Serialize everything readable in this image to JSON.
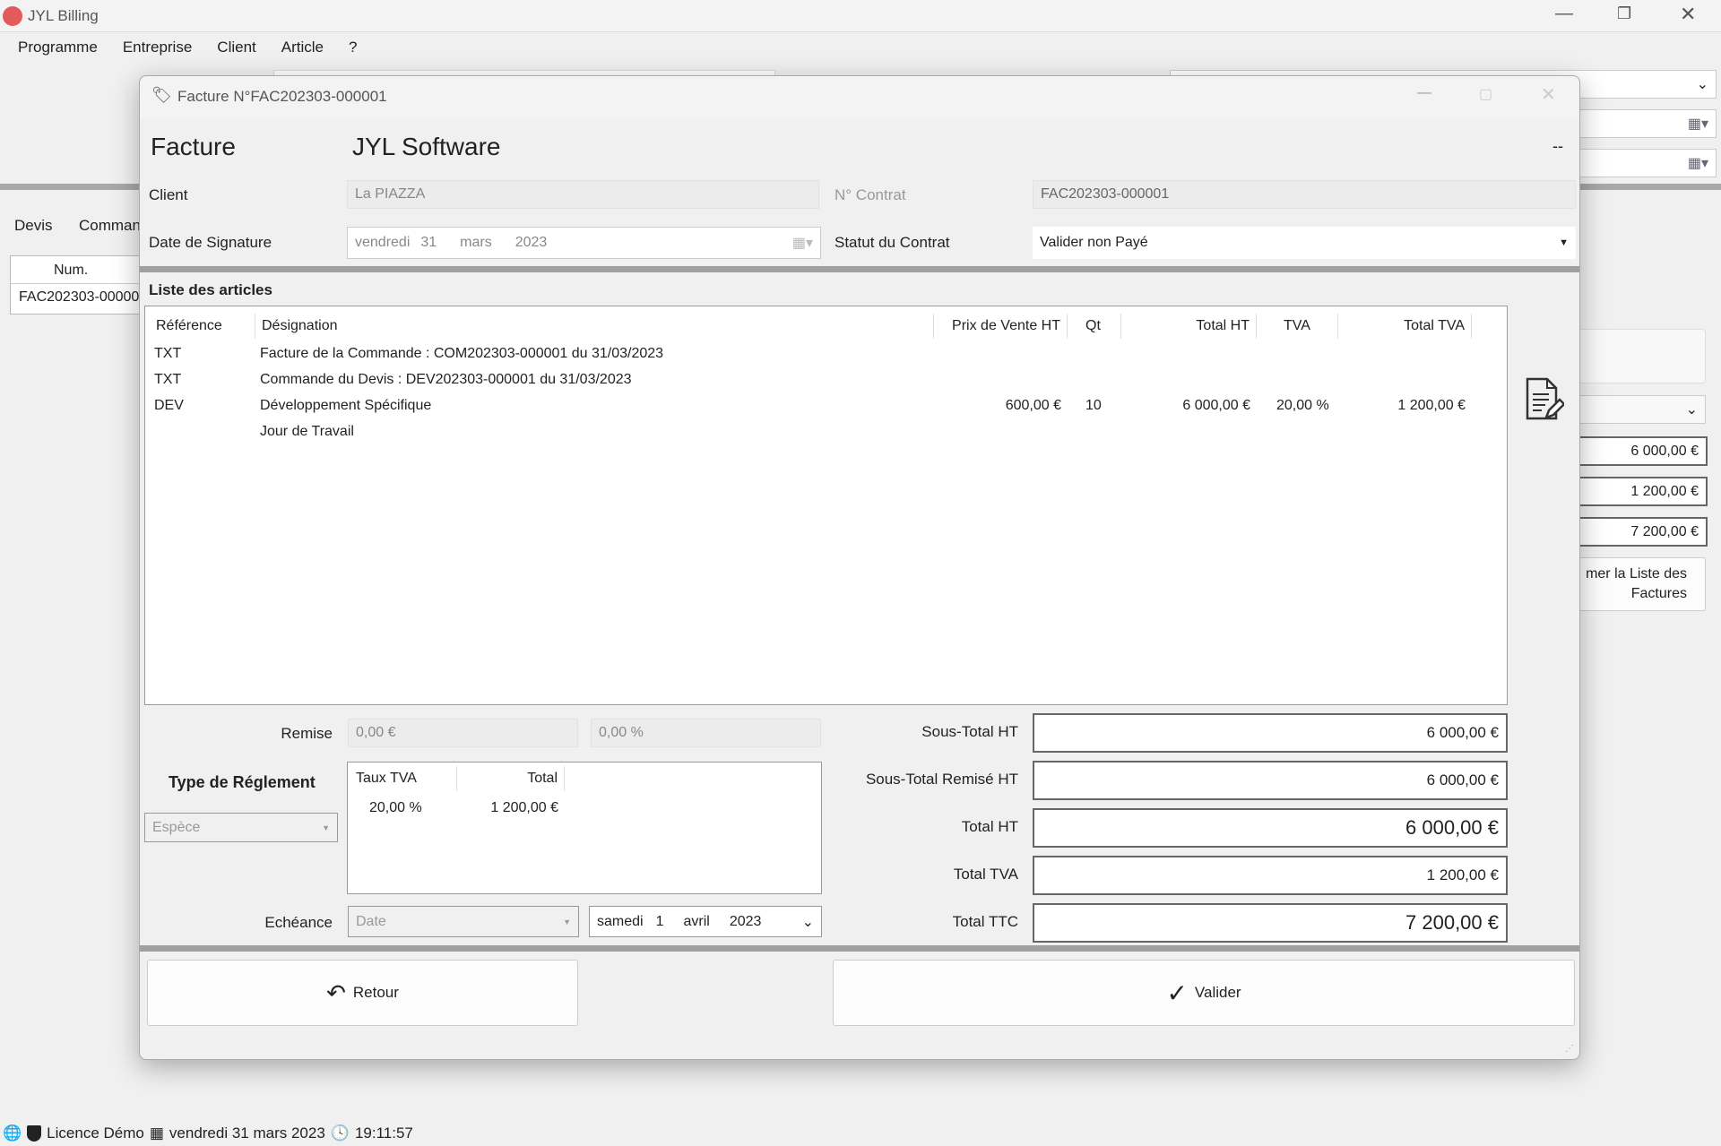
{
  "app": {
    "title": "JYL Billing",
    "menu": [
      "Programme",
      "Entreprise",
      "Client",
      "Article",
      "?"
    ]
  },
  "background": {
    "tabs": [
      "Devis",
      "Comman"
    ],
    "list_header": "Num.",
    "list_row": "FAC202303-00000",
    "right_totals": [
      "6 000,00 €",
      "1 200,00 €",
      "7 200,00 €"
    ],
    "right_button": "mer la Liste des Factures"
  },
  "dialog": {
    "title": "Facture N°FAC202303-000001",
    "heading": "Facture",
    "company": "JYL Software",
    "dashes": "--",
    "client_label": "Client",
    "client_value": "La PIAZZA",
    "contrat_label": "N° Contrat",
    "contrat_value": "FAC202303-000001",
    "signature_label": "Date de Signature",
    "signature_value": {
      "day": "vendredi",
      "date": "31",
      "month": "mars",
      "year": "2023"
    },
    "statut_label": "Statut du Contrat",
    "statut_value": "Valider non Payé",
    "list_title": "Liste des articles",
    "columns": [
      "Référence",
      "Désignation",
      "Prix de Vente HT",
      "Qt",
      "Total HT",
      "TVA",
      "Total TVA"
    ],
    "rows": [
      {
        "ref": "TXT",
        "des": "Facture de la Commande : COM202303-000001 du 31/03/2023",
        "prix": "",
        "qt": "",
        "total_ht": "",
        "tva": "",
        "total_tva": ""
      },
      {
        "ref": "TXT",
        "des": "Commande du Devis : DEV202303-000001 du 31/03/2023",
        "prix": "",
        "qt": "",
        "total_ht": "",
        "tva": "",
        "total_tva": ""
      },
      {
        "ref": "DEV",
        "des": "Développement Spécifique",
        "prix": "600,00 €",
        "qt": "10",
        "total_ht": "6 000,00 €",
        "tva": "20,00 %",
        "total_tva": "1 200,00 €"
      },
      {
        "ref": "",
        "des": "Jour de Travail",
        "prix": "",
        "qt": "",
        "total_ht": "",
        "tva": "",
        "total_tva": ""
      }
    ],
    "remise_label": "Remise",
    "remise_amount": "0,00 €",
    "remise_percent": "0,00 %",
    "reglement_label": "Type de Réglement",
    "reglement_value": "Espèce",
    "tva_table": {
      "columns": [
        "Taux TVA",
        "Total"
      ],
      "row": [
        "20,00 %",
        "1 200,00 €"
      ]
    },
    "echeance_label": "Echéance",
    "echeance_type": "Date",
    "echeance_date": {
      "day": "samedi",
      "date": "1",
      "month": "avril",
      "year": "2023"
    },
    "totals": [
      {
        "label": "Sous-Total HT",
        "value": "6 000,00 €"
      },
      {
        "label": "Sous-Total Remisé HT",
        "value": "6 000,00 €"
      },
      {
        "label": "Total HT",
        "value": "6 000,00 €"
      },
      {
        "label": "Total TVA",
        "value": "1 200,00 €"
      },
      {
        "label": "Total TTC",
        "value": "7 200,00 €"
      }
    ],
    "retour_label": "Retour",
    "valider_label": "Valider"
  },
  "status": {
    "licence": "Licence Démo",
    "date": "vendredi 31 mars 2023",
    "time": "19:11:57"
  }
}
